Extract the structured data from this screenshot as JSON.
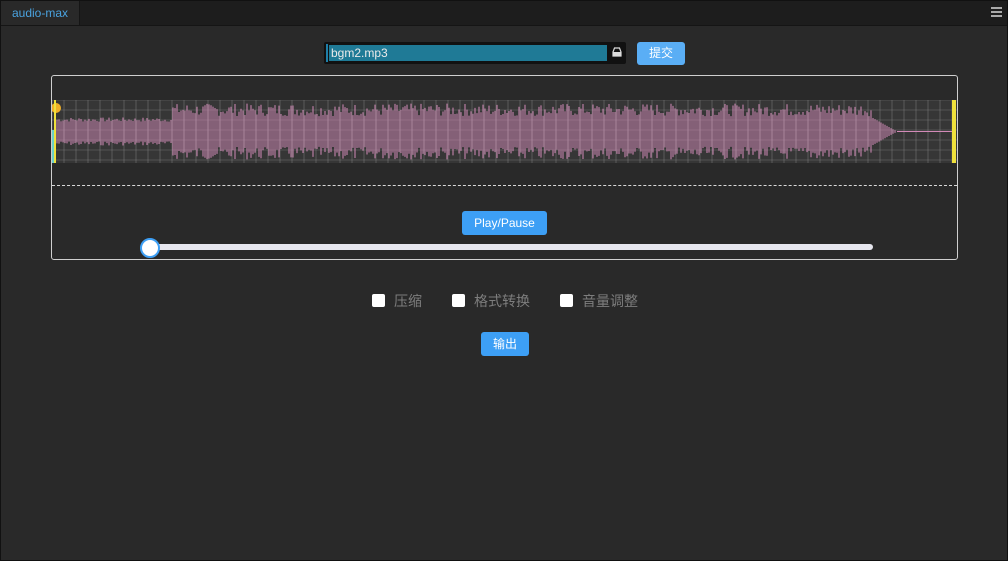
{
  "tab": {
    "label": "audio-max"
  },
  "file": {
    "name": "bgm2.mp3",
    "submit_label": "提交"
  },
  "player": {
    "play_label": "Play/Pause",
    "progress": 0
  },
  "options": [
    {
      "label": "压缩",
      "checked": false
    },
    {
      "label": "格式转换",
      "checked": false
    },
    {
      "label": "音量调整",
      "checked": false
    }
  ],
  "export_label": "输出",
  "colors": {
    "accent": "#3d9ff5",
    "waveform": "#d38ab8",
    "grid": "#8a8a8a",
    "cursor": "#f0e13c"
  }
}
